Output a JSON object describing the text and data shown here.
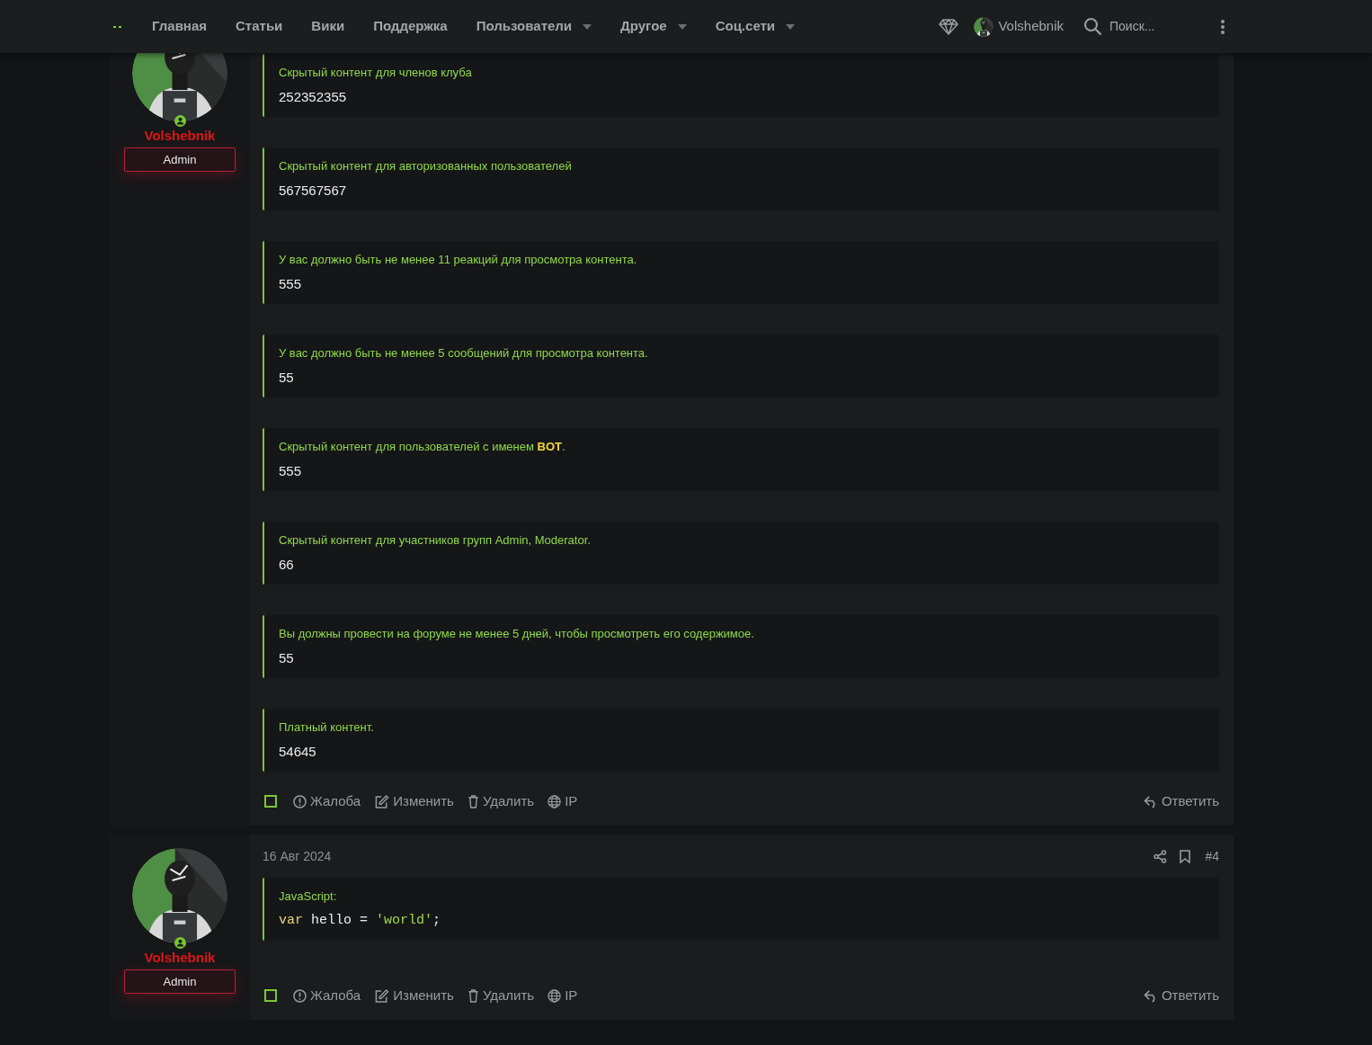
{
  "nav": {
    "items": [
      {
        "label": "Главная",
        "dropdown": false
      },
      {
        "label": "Статьи",
        "dropdown": false
      },
      {
        "label": "Вики",
        "dropdown": false
      },
      {
        "label": "Поддержка",
        "dropdown": false
      },
      {
        "label": "Пользователи",
        "dropdown": true
      },
      {
        "label": "Другое",
        "dropdown": true
      },
      {
        "label": "Соц.сети",
        "dropdown": true
      }
    ],
    "user": "Volshebnik",
    "search_placeholder": "Поиск..."
  },
  "posts": [
    {
      "author": "Volshebnik",
      "role": "Admin",
      "online": true,
      "blocks": [
        {
          "kind": "hidden",
          "title": "Скрытый контент для членов клуба",
          "value": "252352355"
        },
        {
          "kind": "hidden",
          "title": "Скрытый контент для авторизованных пользователей",
          "value": "567567567"
        },
        {
          "kind": "hidden",
          "title": "У вас должно быть не менее 11 реакций для просмотра контента.",
          "value": "555"
        },
        {
          "kind": "hidden",
          "title": "У вас должно быть не менее 5 сообщений для просмотра контента.",
          "value": "55"
        },
        {
          "kind": "hidden",
          "title": "Скрытый контент для пользователей с именем **BOT**.",
          "value": "555"
        },
        {
          "kind": "hidden",
          "title": "Скрытый контент для участников групп Admin, Moderator.",
          "value": "66"
        },
        {
          "kind": "hidden",
          "title": "Вы должны провести на форуме не менее 5 дней, чтобы просмотреть его содержимое.",
          "value": "55"
        },
        {
          "kind": "hidden",
          "title": "Платный контент.",
          "value": "54645"
        }
      ],
      "selected": false,
      "actions": [
        "Жалоба",
        "Изменить",
        "Удалить",
        "IP"
      ],
      "reply": "Ответить"
    },
    {
      "author": "Volshebnik",
      "role": "Admin",
      "online": true,
      "date": "16 Авг 2024",
      "number": "#4",
      "blocks": [
        {
          "kind": "code",
          "title": "JavaScript:",
          "tokens": [
            {
              "text": "var",
              "kind": "keyword"
            },
            {
              "text": " hello = ",
              "kind": "plain"
            },
            {
              "text": "'world'",
              "kind": "string"
            },
            {
              "text": ";",
              "kind": "plain"
            }
          ]
        }
      ],
      "selected": false,
      "actions": [
        "Жалоба",
        "Изменить",
        "Удалить",
        "IP"
      ],
      "reply": "Ответить"
    }
  ]
}
